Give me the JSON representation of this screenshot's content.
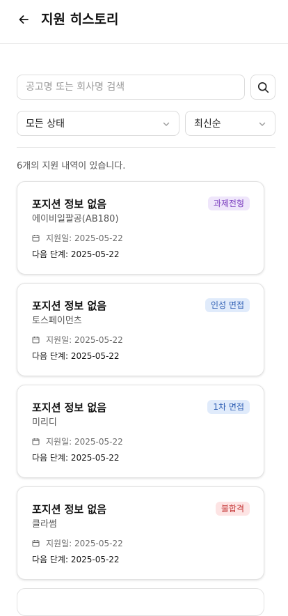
{
  "header": {
    "title": "지원 히스토리"
  },
  "search": {
    "placeholder": "공고명 또는 회사명 검색",
    "value": ""
  },
  "filters": {
    "status_selected": "모든 상태",
    "sort_selected": "최신순"
  },
  "result_count": "6개의 지원 내역이 있습니다.",
  "applications": [
    {
      "title": "포지션 정보 없음",
      "company": "에이비일팔공(AB180)",
      "status": "과제전형",
      "status_colors": {
        "bg": "#efe6fb",
        "text": "#7d3fc0"
      },
      "applied": "지원일: 2025-05-22",
      "next_step": "다음 단계: 2025-05-22"
    },
    {
      "title": "포지션 정보 없음",
      "company": "토스페이먼츠",
      "status": "인성 면접",
      "status_colors": {
        "bg": "#e0ebfb",
        "text": "#2f5fb4"
      },
      "applied": "지원일: 2025-05-22",
      "next_step": "다음 단계: 2025-05-22"
    },
    {
      "title": "포지션 정보 없음",
      "company": "미리디",
      "status": "1차 면접",
      "status_colors": {
        "bg": "#e0ebfb",
        "text": "#2f5fb4"
      },
      "applied": "지원일: 2025-05-22",
      "next_step": "다음 단계: 2025-05-22"
    },
    {
      "title": "포지션 정보 없음",
      "company": "클라썸",
      "status": "불합격",
      "status_colors": {
        "bg": "#fde4e4",
        "text": "#c53737"
      },
      "applied": "지원일: 2025-05-22",
      "next_step": "다음 단계: 2025-05-22"
    }
  ],
  "icons": {
    "back": "arrow-left-icon",
    "search": "search-icon",
    "dropdown": "chevron-down-icon",
    "date": "calendar-icon"
  }
}
